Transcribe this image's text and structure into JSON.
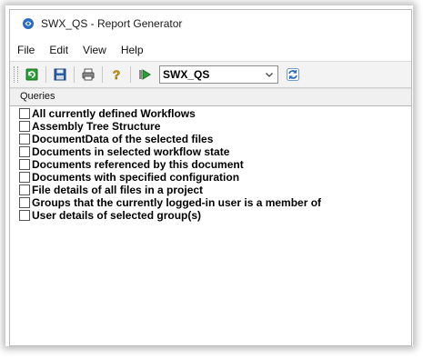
{
  "window": {
    "title": "SWX_QS - Report Generator",
    "icon": "app-logo-icon"
  },
  "menu": {
    "items": [
      "File",
      "Edit",
      "View",
      "Help"
    ]
  },
  "toolbar": {
    "buttons": [
      "refresh-icon",
      "save-icon",
      "print-icon",
      "help-icon",
      "run-icon",
      "sync-icon"
    ],
    "vault_select": "SWX_QS"
  },
  "panel": {
    "header": "Queries"
  },
  "queries": [
    "All currently defined Workflows",
    "Assembly Tree Structure",
    "DocumentData of the selected files",
    "Documents in selected workflow state",
    "Documents referenced by this document",
    "Documents with specified configuration",
    "File details of all files in a project",
    "Groups that the currently logged-in user is a member of",
    "User details of selected group(s)"
  ],
  "colors": {
    "accent": "#2a6bbf",
    "green": "#2e9e3a",
    "help": "#d4a000"
  }
}
